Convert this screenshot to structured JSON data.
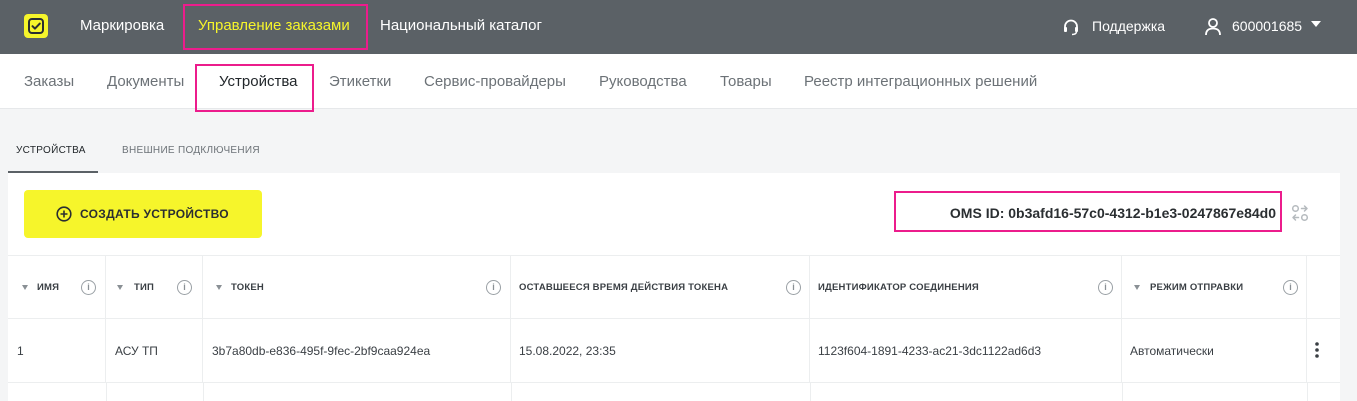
{
  "topbar": {
    "nav": [
      "Маркировка",
      "Управление заказами",
      "Национальный каталог"
    ],
    "support": "Поддержка",
    "user": "600001685"
  },
  "secnav": [
    "Заказы",
    "Документы",
    "Устройства",
    "Этикетки",
    "Сервис-провайдеры",
    "Руководства",
    "Товары",
    "Реестр интеграционных решений"
  ],
  "tabs": [
    "УСТРОЙСТВА",
    "ВНЕШНИЕ ПОДКЛЮЧЕНИЯ"
  ],
  "actions": {
    "create": "СОЗДАТЬ УСТРОЙСТВО"
  },
  "oms": "OMS ID: 0b3afd16-57c0-4312-b1e3-0247867e84d0",
  "table": {
    "columns": [
      "ИМЯ",
      "ТИП",
      "ТОКЕН",
      "ОСТАВШЕЕСЯ ВРЕМЯ ДЕЙСТВИЯ ТОКЕНА",
      "ИДЕНТИФИКАТОР СОЕДИНЕНИЯ",
      "РЕЖИМ ОТПРАВКИ"
    ],
    "rows": [
      [
        "1",
        "АСУ ТП",
        "3b7a80db-e836-495f-9fec-2bf9caa924ea",
        "15.08.2022, 23:35",
        "1123f604-1891-4233-ac21-3dc1122ad6d3",
        "Автоматически"
      ]
    ]
  },
  "colors": {
    "accent": "#f6f52b",
    "highlight": "#ec1c8c",
    "topbar": "#5b6166"
  },
  "icons": [
    "logo-icon",
    "headset-icon",
    "user-icon",
    "caret-down-icon",
    "plus-circle-icon",
    "swap-settings-icon",
    "info-icon",
    "sort-arrow-icon",
    "kebab-menu-icon"
  ]
}
